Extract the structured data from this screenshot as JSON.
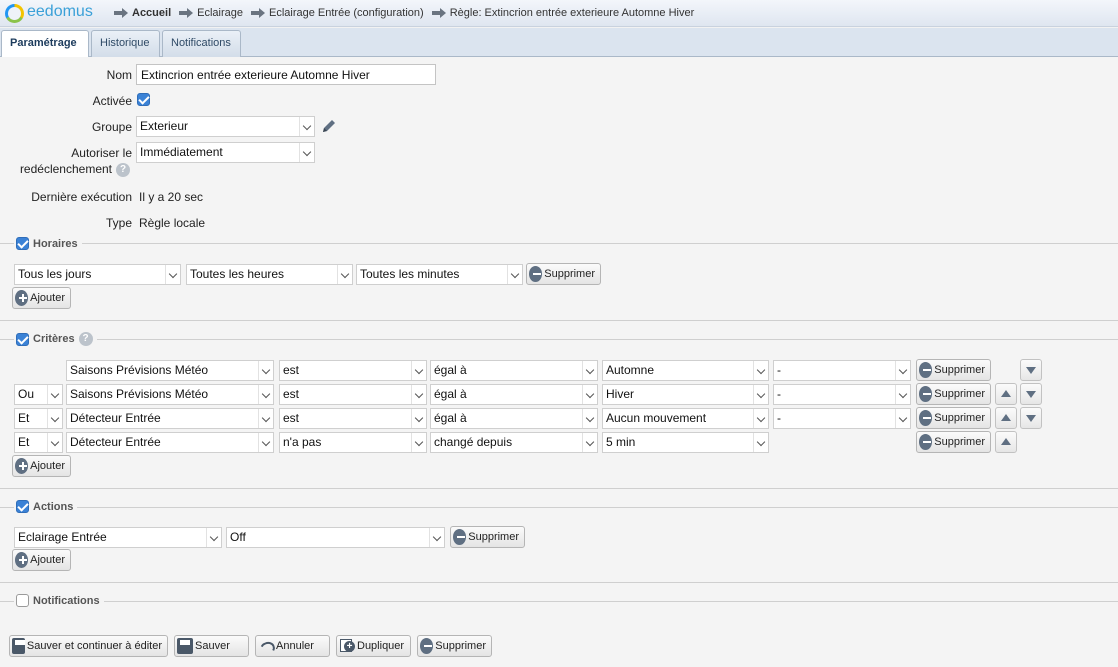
{
  "app": {
    "name": "eedomus"
  },
  "breadcrumb": [
    "Accueil",
    "Eclairage",
    "Eclairage Entrée (configuration)",
    "Règle: Extincrion entrée exterieure Automne Hiver"
  ],
  "tabs": [
    "Paramétrage",
    "Historique",
    "Notifications"
  ],
  "form": {
    "nom_label": "Nom",
    "nom_value": "Extincrion entrée exterieure Automne Hiver",
    "activee_label": "Activée",
    "groupe_label": "Groupe",
    "groupe_value": "Exterieur",
    "autoriser_label_1": "Autoriser le",
    "autoriser_label_2": "redéclenchement",
    "autoriser_value": "Immédiatement",
    "help_glyph": "?",
    "derniere_label": "Dernière exécution",
    "derniere_value": "Il y a 20 sec",
    "type_label": "Type",
    "type_value": "Règle locale"
  },
  "horaires": {
    "title": "Horaires",
    "checked": true,
    "row": [
      "Tous les jours",
      "Toutes les heures",
      "Toutes les minutes"
    ],
    "supprimer": "Supprimer",
    "ajouter": "Ajouter"
  },
  "criteres": {
    "title": "Critères",
    "checked": true,
    "rows": [
      {
        "conj": "",
        "device": "Saisons Prévisions Météo",
        "op": "est",
        "cmp": "égal à",
        "value": "Automne",
        "extra": "-"
      },
      {
        "conj": "Ou",
        "device": "Saisons Prévisions Météo",
        "op": "est",
        "cmp": "égal à",
        "value": "Hiver",
        "extra": "-"
      },
      {
        "conj": "Et",
        "device": "Détecteur Entrée",
        "op": "est",
        "cmp": "égal à",
        "value": "Aucun mouvement",
        "extra": "-"
      },
      {
        "conj": "Et",
        "device": "Détecteur Entrée",
        "op": "n'a pas",
        "cmp": "changé depuis",
        "value": "5 min",
        "extra": ""
      }
    ],
    "supprimer": "Supprimer",
    "ajouter": "Ajouter"
  },
  "actions": {
    "title": "Actions",
    "checked": true,
    "row": [
      "Eclairage Entrée",
      "Off"
    ],
    "supprimer": "Supprimer",
    "ajouter": "Ajouter"
  },
  "notifications": {
    "title": "Notifications",
    "checked": false
  },
  "footer": {
    "save_continue": "Sauver et continuer à éditer",
    "save": "Sauver",
    "cancel": "Annuler",
    "duplicate": "Dupliquer",
    "delete": "Supprimer"
  }
}
